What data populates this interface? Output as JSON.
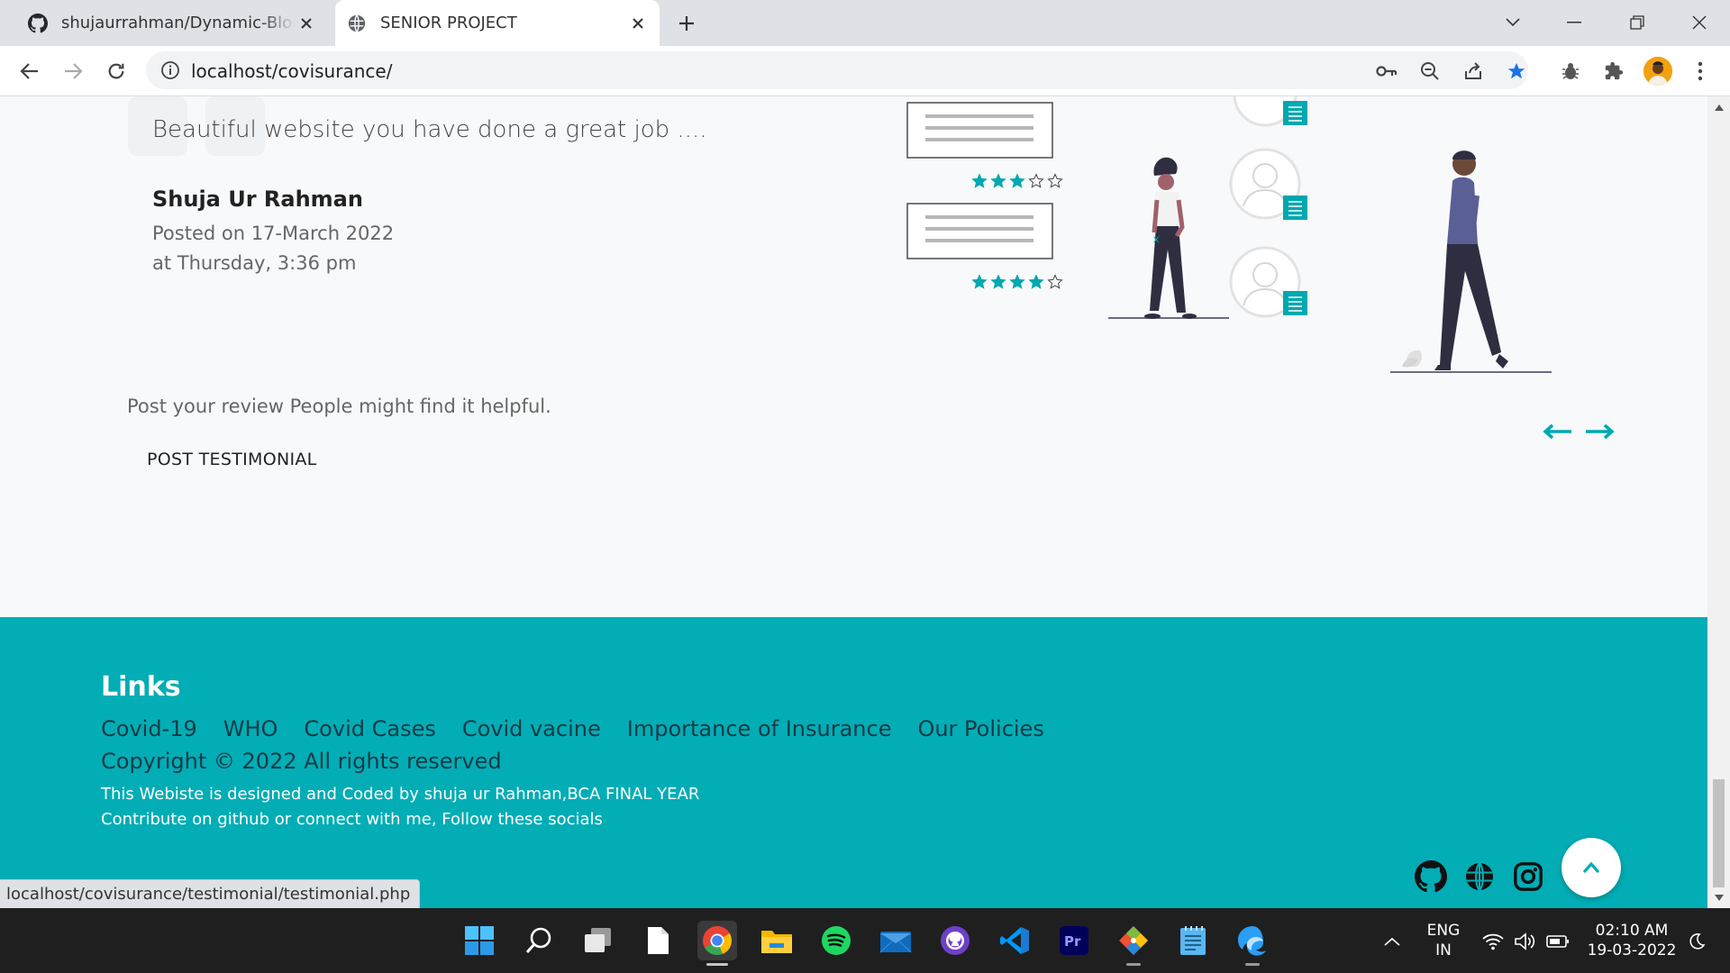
{
  "browser": {
    "tabs": [
      {
        "title": "shujaurrahman/Dynamic-Blogger",
        "icon": "github-icon"
      },
      {
        "title": "SENIOR PROJECT",
        "icon": "globe-icon",
        "active": true
      }
    ],
    "url": "localhost/covisurance/"
  },
  "testimonial": {
    "text": "Beautiful website you have done a great job ....",
    "name": "Shuja Ur Rahman",
    "posted_on": "Posted on 17-March 2022",
    "posted_at": "at Thursday, 3:36 pm",
    "review_cards": [
      {
        "rating": 3,
        "out_of": 5
      },
      {
        "rating": 4,
        "out_of": 5
      }
    ]
  },
  "cta": {
    "prompt": "Post your review People might find it helpful.",
    "button": "POST TESTIMONIAL"
  },
  "footer": {
    "links_title": "Links",
    "links": [
      "Covid-19",
      "WHO",
      "Covid Cases",
      "Covid vacine",
      "Importance of Insurance",
      "Our Policies"
    ],
    "copyright": "Copyright © 2022 All rights reserved",
    "credit": "This Webiste is designed and Coded by shuja ur Rahman,BCA FINAL YEAR",
    "contribute": "Contribute on github or connect with me, Follow these socials",
    "socials": [
      "github-icon",
      "globe-icon",
      "instagram-icon"
    ]
  },
  "status_bar": {
    "url": "localhost/covisurance/testimonial/testimonial.php"
  },
  "taskbar": {
    "apps": [
      "windows-start-icon",
      "search-icon",
      "task-view-icon",
      "file-icon",
      "chrome-icon",
      "file-explorer-icon",
      "spotify-icon",
      "mail-icon",
      "github-desktop-icon",
      "vscode-icon",
      "premiere-pro-icon",
      "git-icon",
      "notepad-icon",
      "edge-beta-icon"
    ],
    "language": "ENG",
    "region": "IN",
    "time": "02:10 AM",
    "date": "19-03-2022"
  },
  "colors": {
    "accent": "#02adb5",
    "tab_bar": "#dee1e6",
    "taskbar": "#1f1f1f",
    "star": "#00a8b0",
    "figure_shirt": "#5a5f96"
  }
}
